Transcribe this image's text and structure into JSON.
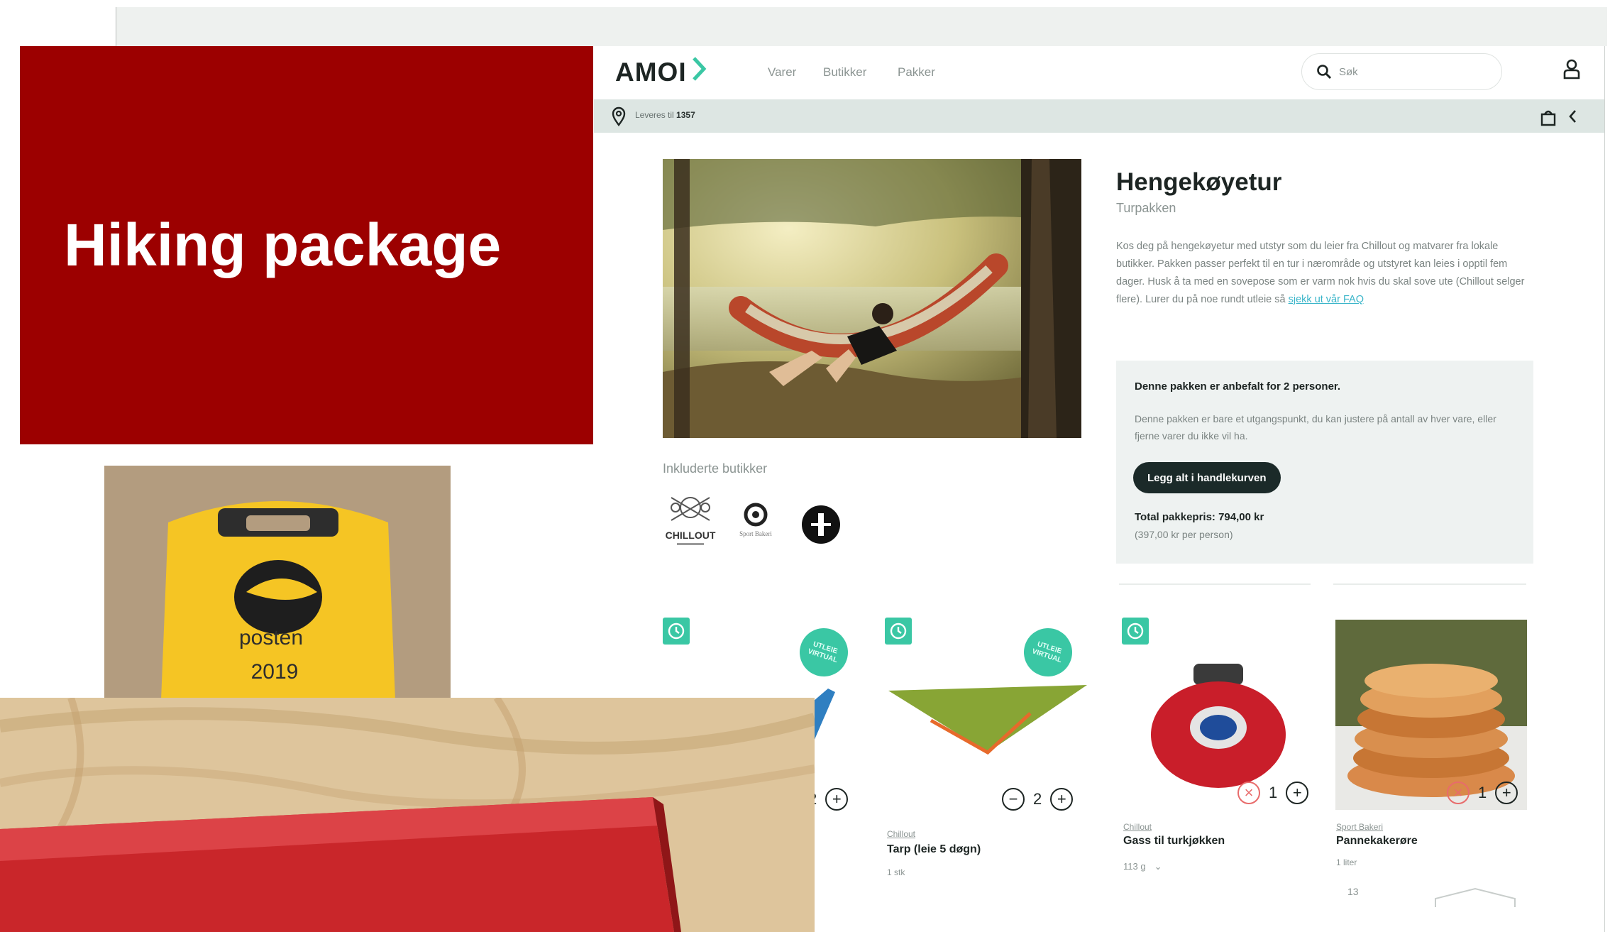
{
  "slide": {
    "title": "Hiking package",
    "bag_print_brand": "posten",
    "bag_print_year": "2019"
  },
  "header": {
    "logo": "AMOI",
    "nav": [
      "Varer",
      "Butikker",
      "Pakker"
    ],
    "search_placeholder": "Søk"
  },
  "subbar": {
    "deliver_label": "Leveres til",
    "postcode": "1357"
  },
  "package": {
    "title": "Hengekøyetur",
    "subtitle": "Turpakken",
    "description": "Kos deg på hengekøyetur med utstyr som du leier fra Chillout og matvarer fra lokale butikker. Pakken passer perfekt til en tur i nærområde og utstyret kan leies i opptil fem dager. Husk å ta med en sovepose som er varm nok hvis du skal sove ute (Chillout selger flere). Lurer du på noe rundt utleie så",
    "faq_link": "sjekk ut vår FAQ",
    "included_stores_label": "Inkluderte butikker",
    "store_logo_chillout": "CHILLOUT",
    "store_logo_sport": "Sport Bakeri"
  },
  "recommendation": {
    "title": "Denne pakken er anbefalt for 2 personer.",
    "text": "Denne pakken er bare et utgangspunkt, du kan justere på antall av hver vare, eller fjerne varer du ikke vil ha.",
    "add_all_button": "Legg alt i handlekurven",
    "total_label": "Total pakkepris: 794,00 kr",
    "per_person": "(397,00 kr per person)"
  },
  "products": [
    {
      "stamp": "UTLEIE VIRTUAL",
      "qty": "2"
    },
    {
      "stamp": "UTLEIE VIRTUAL",
      "qty": "2",
      "shop": "Chillout",
      "name": "Tarp (leie 5 døgn)",
      "meta": "1 stk"
    },
    {
      "qty": "1",
      "shop": "Chillout",
      "name": "Gass til turkjøkken",
      "select_value": "113 g",
      "select_caret": "⌄"
    },
    {
      "qty": "1",
      "shop": "Sport Bakeri",
      "name": "Pannekakerøre",
      "meta": "1 liter",
      "extra": "13"
    }
  ],
  "colors": {
    "accent": "#3ac7a4",
    "slide_red": "#9c0000",
    "dark_button": "#1b2a29"
  }
}
